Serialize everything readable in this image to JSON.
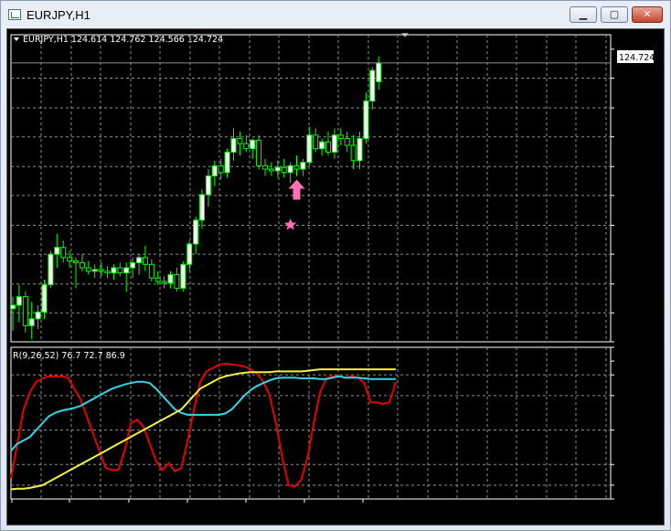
{
  "window": {
    "title": "EURJPY,H1",
    "controls": {
      "minimize": "▁",
      "maximize": "▢",
      "close": "✕"
    }
  },
  "price_header": "EURJPY,H1  124.614 124.762 124.566 124.724",
  "indicator_header": "R(9,26,52) 76.7 72.7 86.9",
  "current_price_label": "124.724",
  "colors": {
    "background": "#000000",
    "grid": "#8c8c8c",
    "candle_up": "#ffffff",
    "candle_outline": "#00ff00",
    "candle_down": "#000000",
    "arrow": "#ff6fb5",
    "star": "#ff6fb5",
    "series_red": "#e60000",
    "series_cyan": "#33d6e6",
    "series_yellow": "#f2f23a"
  },
  "chart_data": [
    {
      "type": "candlestick",
      "title": "EURJPY,H1  124.614 124.762 124.566 124.724",
      "ylim": [
        123.085,
        124.89
      ],
      "y_ticks": [
        "124.805",
        "124.635",
        "124.460",
        "124.290",
        "124.115",
        "123.945",
        "123.770",
        "123.600",
        "123.425",
        "123.255",
        "123.085"
      ],
      "x_ticks": [
        "16 Oct 2020",
        "16 Oct 17:00",
        "19 Oct 01:00",
        "19 Oct 09:00",
        "19 Oct 17:00",
        "20 Oct 01:00",
        "20 Oct 09:00"
      ],
      "candles": [
        [
          123.28,
          123.35,
          123.15,
          123.3
        ],
        [
          123.3,
          123.42,
          123.2,
          123.35
        ],
        [
          123.35,
          123.38,
          123.14,
          123.18
        ],
        [
          123.18,
          123.32,
          123.1,
          123.22
        ],
        [
          123.22,
          123.3,
          123.16,
          123.26
        ],
        [
          123.26,
          123.45,
          123.22,
          123.42
        ],
        [
          123.42,
          123.62,
          123.4,
          123.6
        ],
        [
          123.6,
          123.72,
          123.52,
          123.64
        ],
        [
          123.64,
          123.68,
          123.55,
          123.58
        ],
        [
          123.58,
          123.62,
          123.52,
          123.56
        ],
        [
          123.56,
          123.58,
          123.4,
          123.55
        ],
        [
          123.55,
          123.6,
          123.5,
          123.52
        ],
        [
          123.52,
          123.56,
          123.48,
          123.5
        ],
        [
          123.5,
          123.54,
          123.46,
          123.51
        ],
        [
          123.51,
          123.55,
          123.47,
          123.5
        ],
        [
          123.5,
          123.53,
          123.46,
          123.49
        ],
        [
          123.49,
          123.54,
          123.45,
          123.52
        ],
        [
          123.52,
          123.55,
          123.47,
          123.49
        ],
        [
          123.49,
          123.55,
          123.38,
          123.52
        ],
        [
          123.52,
          123.58,
          123.46,
          123.55
        ],
        [
          123.55,
          123.6,
          123.48,
          123.58
        ],
        [
          123.58,
          123.65,
          123.5,
          123.54
        ],
        [
          123.54,
          123.57,
          123.44,
          123.46
        ],
        [
          123.46,
          123.5,
          123.42,
          123.44
        ],
        [
          123.44,
          123.47,
          123.4,
          123.43
        ],
        [
          123.43,
          123.5,
          123.4,
          123.48
        ],
        [
          123.48,
          123.52,
          123.38,
          123.4
        ],
        [
          123.4,
          123.56,
          123.38,
          123.54
        ],
        [
          123.54,
          123.68,
          123.5,
          123.66
        ],
        [
          123.66,
          123.82,
          123.6,
          123.8
        ],
        [
          123.8,
          123.98,
          123.75,
          123.95
        ],
        [
          123.95,
          124.1,
          123.88,
          124.06
        ],
        [
          124.06,
          124.15,
          124.0,
          124.12
        ],
        [
          124.12,
          124.16,
          124.04,
          124.08
        ],
        [
          124.08,
          124.22,
          124.05,
          124.2
        ],
        [
          124.2,
          124.34,
          124.15,
          124.28
        ],
        [
          124.28,
          124.32,
          124.18,
          124.25
        ],
        [
          124.25,
          124.3,
          124.2,
          124.22
        ],
        [
          124.22,
          124.28,
          124.16,
          124.27
        ],
        [
          124.27,
          124.3,
          124.1,
          124.12
        ],
        [
          124.12,
          124.16,
          124.06,
          124.1
        ],
        [
          124.1,
          124.14,
          124.06,
          124.09
        ],
        [
          124.09,
          124.15,
          124.05,
          124.11
        ],
        [
          124.11,
          124.16,
          124.05,
          124.08
        ],
        [
          124.08,
          124.14,
          124.02,
          124.12
        ],
        [
          124.12,
          124.18,
          124.06,
          124.1
        ],
        [
          124.1,
          124.16,
          124.06,
          124.14
        ],
        [
          124.14,
          124.35,
          124.12,
          124.3
        ],
        [
          124.3,
          124.34,
          124.2,
          124.22
        ],
        [
          124.22,
          124.28,
          124.18,
          124.26
        ],
        [
          124.26,
          124.32,
          124.18,
          124.2
        ],
        [
          124.2,
          124.34,
          124.16,
          124.3
        ],
        [
          124.3,
          124.34,
          124.24,
          124.28
        ],
        [
          124.28,
          124.32,
          124.2,
          124.24
        ],
        [
          124.24,
          124.3,
          124.1,
          124.15
        ],
        [
          124.15,
          124.32,
          124.1,
          124.28
        ],
        [
          124.28,
          124.55,
          124.25,
          124.5
        ],
        [
          124.5,
          124.7,
          124.45,
          124.68
        ],
        [
          124.614,
          124.762,
          124.566,
          124.724
        ]
      ],
      "signals": [
        {
          "type": "buy-arrow",
          "index": 45
        },
        {
          "type": "star",
          "index": 44
        }
      ]
    },
    {
      "type": "line",
      "title": "R(9,26,52) 76.7 72.7 86.9",
      "ylim": [
        -100,
        120
      ],
      "y_ticks": [
        "120",
        "100",
        "80",
        "50",
        "0.00",
        "-50",
        "-80",
        "-100"
      ],
      "series": [
        {
          "color": "#e60000",
          "values": [
            -70,
            -20,
            30,
            55,
            70,
            75,
            78,
            78,
            78,
            76,
            60,
            45,
            20,
            -5,
            -30,
            -55,
            -58,
            -58,
            -30,
            10,
            15,
            5,
            -20,
            -45,
            -58,
            -48,
            -60,
            -55,
            -15,
            30,
            70,
            85,
            90,
            95,
            96,
            95,
            94,
            92,
            88,
            82,
            70,
            50,
            10,
            -40,
            -80,
            -82,
            -72,
            -40,
            10,
            55,
            75,
            78,
            78,
            76,
            78,
            76,
            68,
            40,
            40,
            38,
            40,
            70
          ]
        },
        {
          "color": "#33d6e6",
          "values": [
            -30,
            -20,
            -15,
            -10,
            0,
            10,
            20,
            25,
            28,
            30,
            32,
            35,
            40,
            45,
            50,
            55,
            60,
            63,
            66,
            68,
            70,
            70,
            68,
            60,
            50,
            40,
            30,
            25,
            22,
            22,
            22,
            22,
            22,
            22,
            24,
            30,
            40,
            50,
            58,
            64,
            68,
            72,
            75,
            76,
            76,
            76,
            75,
            75,
            75,
            74,
            74,
            76,
            78,
            76,
            76,
            76,
            75,
            74,
            74,
            74,
            74,
            74
          ]
        },
        {
          "color": "#f2f23a",
          "values": [
            -86,
            -85,
            -85,
            -84,
            -82,
            -80,
            -75,
            -70,
            -65,
            -60,
            -55,
            -50,
            -45,
            -40,
            -35,
            -30,
            -25,
            -20,
            -15,
            -10,
            -5,
            0,
            5,
            10,
            15,
            20,
            25,
            30,
            40,
            50,
            60,
            65,
            70,
            75,
            78,
            80,
            82,
            83,
            84,
            84,
            84,
            84,
            85,
            85,
            85,
            85,
            85,
            86,
            87,
            88,
            88,
            88,
            88,
            88,
            88,
            88,
            88,
            88,
            88,
            88,
            88,
            88
          ]
        }
      ]
    }
  ]
}
